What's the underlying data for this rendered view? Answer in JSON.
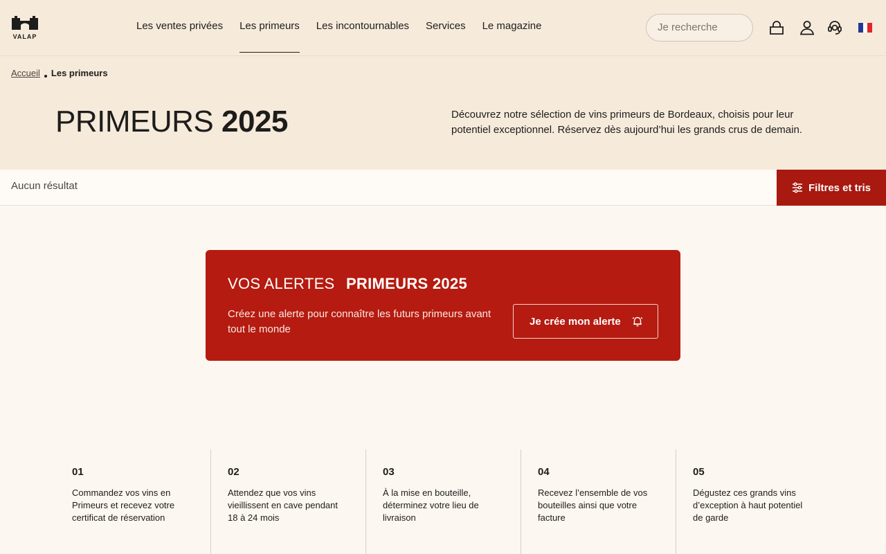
{
  "header": {
    "logo_text": "VALAP",
    "nav": [
      {
        "label": "Les ventes privées",
        "active": false
      },
      {
        "label": "Les primeurs",
        "active": true
      },
      {
        "label": "Les incontournables",
        "active": false
      },
      {
        "label": "Services",
        "active": false
      },
      {
        "label": "Le magazine",
        "active": false
      }
    ],
    "search_placeholder": "Je recherche",
    "icons": [
      "bag-icon",
      "user-icon",
      "support-icon",
      "french-flag-icon"
    ]
  },
  "breadcrumb": {
    "home": "Accueil",
    "current": "Les primeurs"
  },
  "hero": {
    "title_light": "PRIMEURS",
    "title_bold": "2025",
    "description": "Découvrez notre sélection de vins primeurs de Bordeaux, choisis pour leur potentiel exceptionnel. Réservez dès aujourd’hui les grands crus de demain."
  },
  "toolbar": {
    "result_count": "Aucun résultat",
    "filter_label": "Filtres et tris"
  },
  "alert": {
    "title_light": "VOS ALERTES",
    "title_bold": "PRIMEURS 2025",
    "description": "Créez une alerte pour connaître les futurs primeurs avant tout le monde",
    "button_label": "Je crée mon alerte"
  },
  "steps": [
    {
      "num": "01",
      "text": "Commandez vos vins en Primeurs et recevez votre certificat de réservation"
    },
    {
      "num": "02",
      "text": "Attendez que vos vins vieillissent en cave pendant 18 à 24 mois"
    },
    {
      "num": "03",
      "text": "À la mise en bouteille, déterminez votre lieu de livraison"
    },
    {
      "num": "04",
      "text": "Recevez l’ensemble de vos bouteilles ainsi que votre facture"
    },
    {
      "num": "05",
      "text": "Dégustez ces grands vins d’exception à haut potentiel de garde"
    }
  ],
  "colors": {
    "accent": "#b51b10",
    "filter_button": "#a8190f",
    "header_bg": "#f6eadb",
    "page_bg": "#fdf7f1"
  }
}
